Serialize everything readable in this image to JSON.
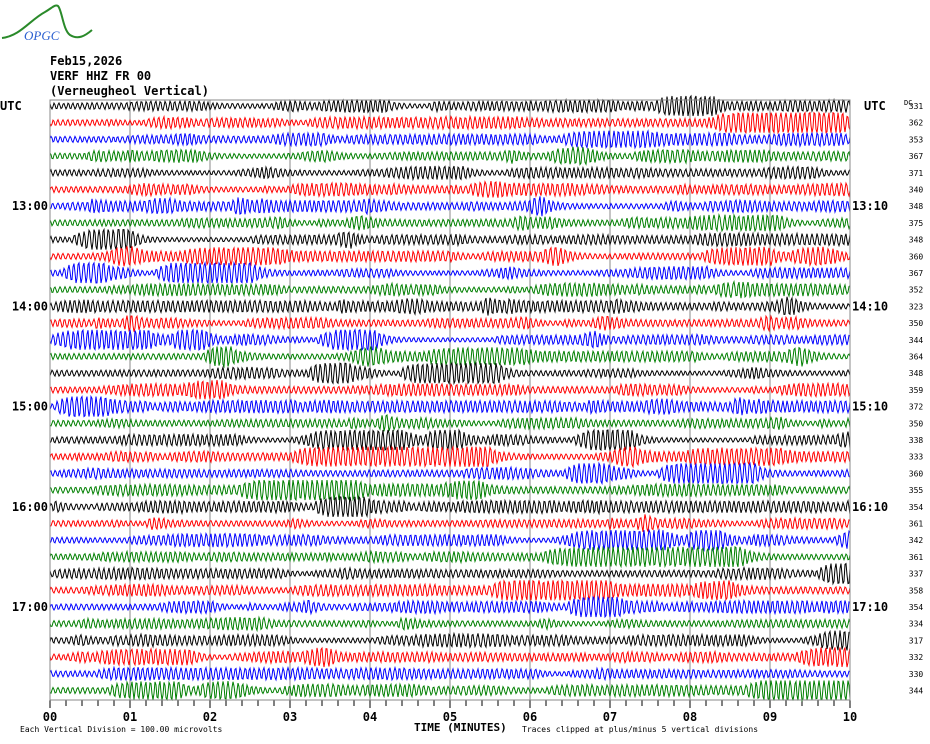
{
  "header": {
    "logo_text": "OPGC",
    "date": "Feb15,2026",
    "station": "VERF HHZ FR 00",
    "station_name": "(Verneugheol Vertical)",
    "utc_left": "UTC",
    "utc_right": "UTC",
    "dc_label": "DC"
  },
  "footer": {
    "scale_note": "Each Vertical Division =  100.00 microvolts",
    "clip_note": "Traces clipped at plus/minus 5 vertical divisions"
  },
  "chart_data": {
    "type": "line",
    "title": "VERF HHZ FR 00 (Verneugheol Vertical) Feb15,2026",
    "xlabel": "TIME (MINUTES)",
    "xlim": [
      0,
      10
    ],
    "x_ticks": [
      "00",
      "01",
      "02",
      "03",
      "04",
      "05",
      "06",
      "07",
      "08",
      "09",
      "10"
    ],
    "trace_minutes": 10,
    "trace_count": 36,
    "trace_colors": [
      "#000000",
      "#ff0000",
      "#0000ff",
      "#007f00"
    ],
    "left_labels": [
      {
        "trace": 6,
        "text": "13:00"
      },
      {
        "trace": 12,
        "text": "14:00"
      },
      {
        "trace": 18,
        "text": "15:00"
      },
      {
        "trace": 24,
        "text": "16:00"
      },
      {
        "trace": 30,
        "text": "17:00"
      }
    ],
    "right_labels": [
      {
        "trace": 6,
        "text": "13:10"
      },
      {
        "trace": 12,
        "text": "14:10"
      },
      {
        "trace": 18,
        "text": "15:10"
      },
      {
        "trace": 24,
        "text": "16:10"
      },
      {
        "trace": 30,
        "text": "17:10"
      }
    ],
    "dc_offsets": [
      331,
      362,
      353,
      367,
      371,
      340,
      348,
      375,
      348,
      360,
      367,
      352,
      323,
      350,
      344,
      364,
      348,
      359,
      372,
      350,
      338,
      333,
      360,
      355,
      354,
      361,
      342,
      361,
      337,
      358,
      354,
      334,
      317,
      332,
      330,
      344
    ]
  }
}
